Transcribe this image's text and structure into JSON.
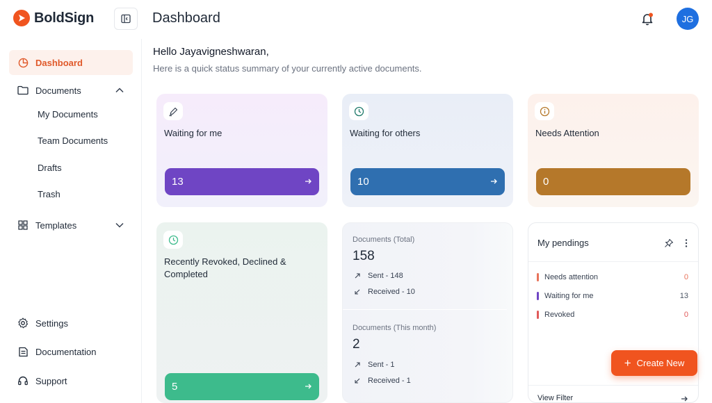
{
  "app": {
    "name": "BoldSign",
    "page_title": "Dashboard",
    "avatar_initials": "JG",
    "brand_color": "#f0541f"
  },
  "sidebar": {
    "dashboard": "Dashboard",
    "documents": "Documents",
    "documents_children": [
      "My Documents",
      "Team Documents",
      "Drafts",
      "Trash"
    ],
    "templates": "Templates",
    "settings": "Settings",
    "documentation": "Documentation",
    "support": "Support"
  },
  "main": {
    "greeting": "Hello Jayavigneshwaran,",
    "subline": "Here is a quick status summary of your currently active documents.",
    "cards": [
      {
        "label": "Waiting for me",
        "count": "13",
        "icon": "pen-icon",
        "color": "#6f45c4"
      },
      {
        "label": "Waiting for others",
        "count": "10",
        "icon": "clock-icon",
        "color": "#2f6fb0"
      },
      {
        "label": "Needs Attention",
        "count": "0",
        "icon": "info-icon",
        "color": "#b5782a"
      },
      {
        "label": "Recently Revoked, Declined & Completed",
        "count": "5",
        "icon": "clock-icon",
        "color": "#3dbb8c"
      }
    ],
    "stats": {
      "total_label": "Documents (Total)",
      "total_value": "158",
      "total_sent": "Sent - 148",
      "total_received": "Received - 10",
      "month_label": "Documents (This month)",
      "month_value": "2",
      "month_sent": "Sent - 1",
      "month_received": "Received - 1"
    },
    "pendings": {
      "title": "My pendings",
      "rows": [
        {
          "label": "Needs attention",
          "value": "0",
          "color": "#e8735a"
        },
        {
          "label": "Waiting for me",
          "value": "13",
          "color": "#6f45c4"
        },
        {
          "label": "Revoked",
          "value": "0",
          "color": "#e05a5a"
        }
      ],
      "view_filter": "View Filter"
    },
    "create_new": "Create New"
  }
}
